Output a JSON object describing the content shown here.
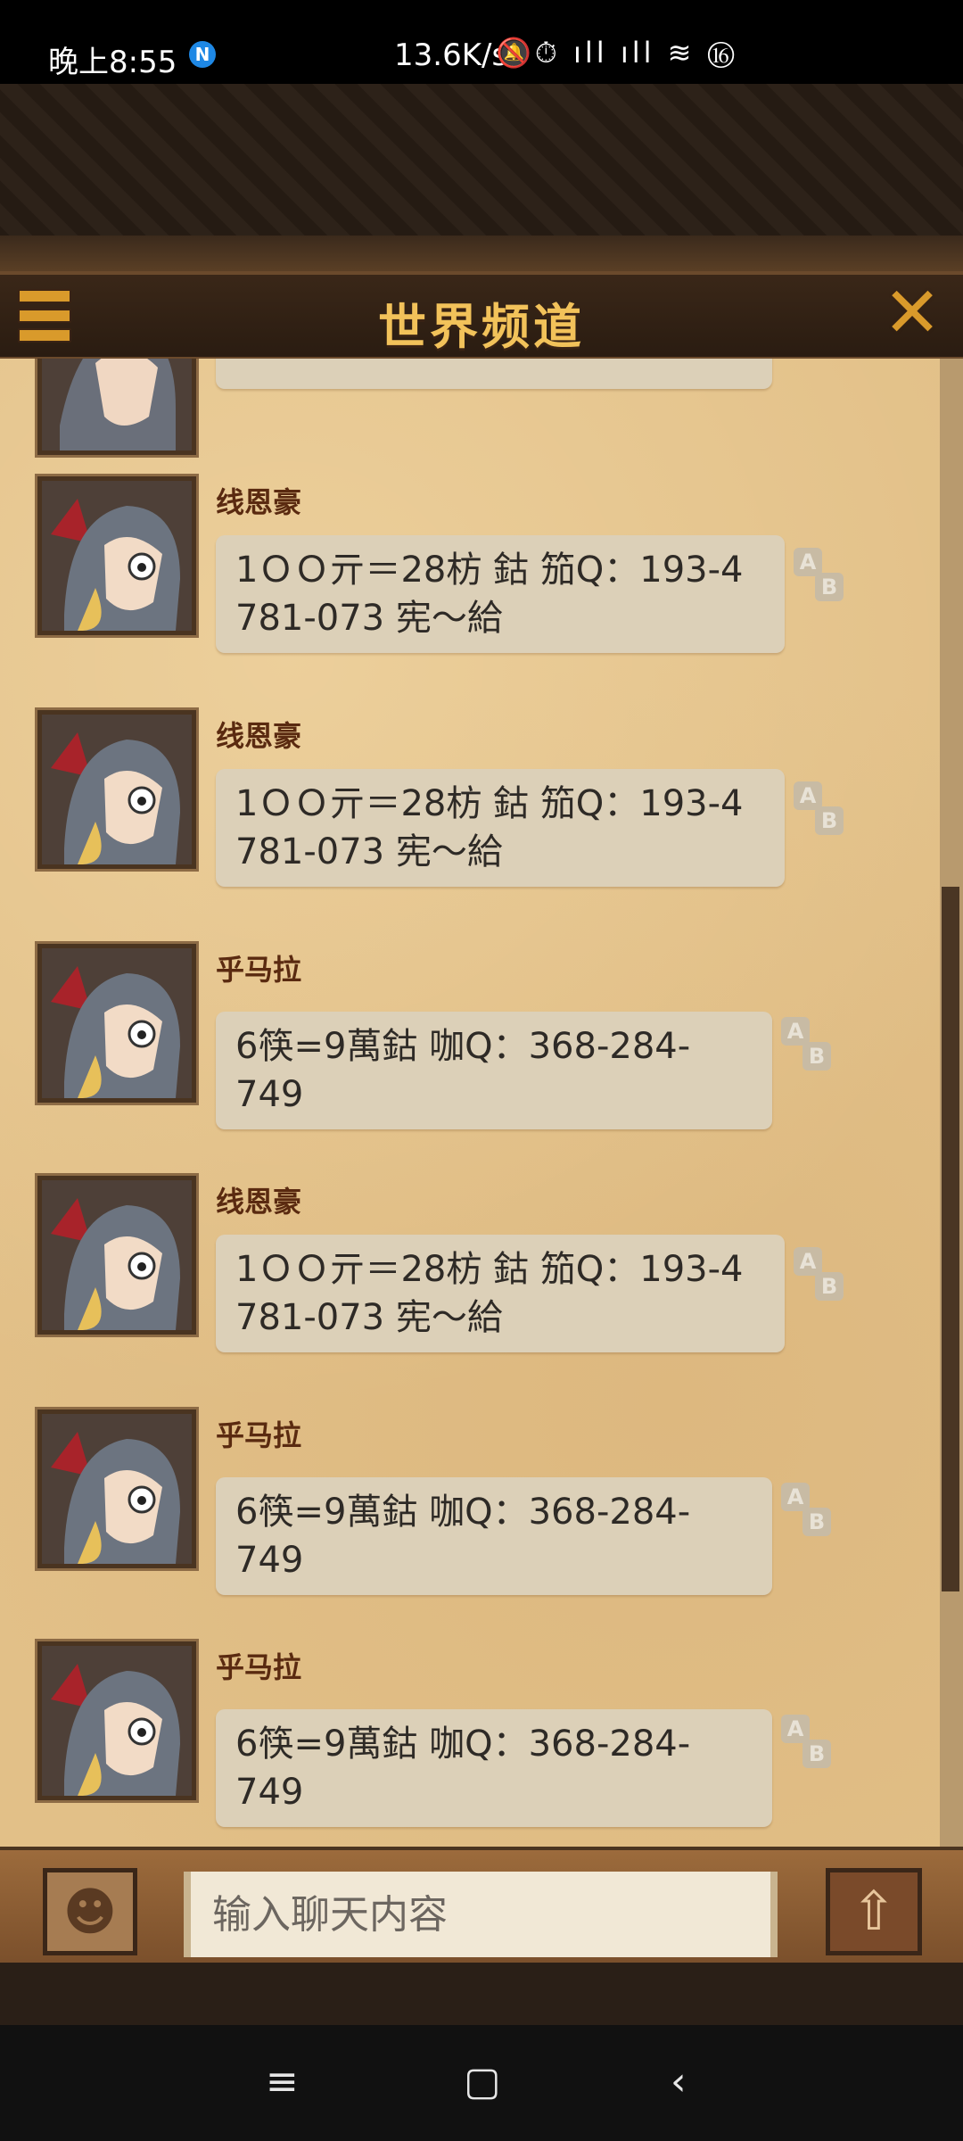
{
  "status_bar": {
    "time": "晚上8:55",
    "app_badge": "N",
    "speed": "13.6K/s",
    "icons": "🔕⏱ ıll ıll ≋ ⑯"
  },
  "header": {
    "title": "世界频道",
    "close_glyph": "✕"
  },
  "messages": [
    {
      "name": "线恩豪",
      "lines": [
        "1ＯＯ亓＝28枋 鈷 笳Q：193-4",
        "781-073 宪～給"
      ]
    },
    {
      "name": "线恩豪",
      "lines": [
        "1ＯＯ亓＝28枋 鈷 笳Q：193-4",
        "781-073 宪～給"
      ]
    },
    {
      "name": "乎马拉",
      "lines": [
        "6筷=9萬鈷 咖Q：368-284-749"
      ]
    },
    {
      "name": "线恩豪",
      "lines": [
        "1ＯＯ亓＝28枋 鈷 笳Q：193-4",
        "781-073 宪～給"
      ]
    },
    {
      "name": "乎马拉",
      "lines": [
        "6筷=9萬鈷 咖Q：368-284-749"
      ]
    },
    {
      "name": "乎马拉",
      "lines": [
        "6筷=9萬鈷 咖Q：368-284-749"
      ]
    }
  ],
  "translate_label": {
    "a": "A",
    "b": "B"
  },
  "footer": {
    "emoji_glyph": "☻",
    "input_placeholder": "输入聊天内容",
    "send_glyph": "⇧"
  },
  "navbar": {
    "menu": "≡",
    "home": "▢",
    "back": "‹"
  }
}
